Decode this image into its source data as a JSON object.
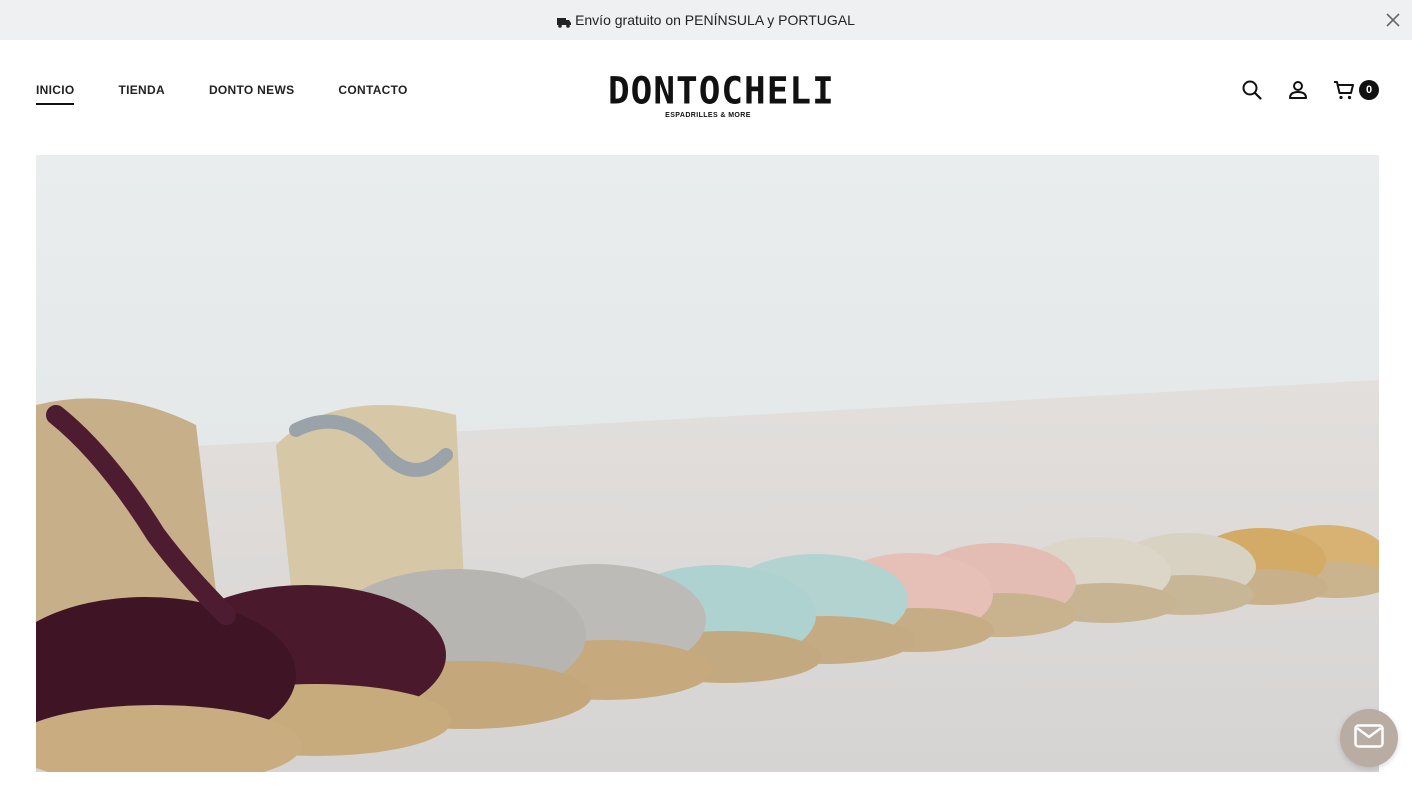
{
  "announcement": {
    "icon": "truck-icon",
    "text": "Envío gratuito on PENÍNSULA y PORTUGAL",
    "close_icon": "close-icon"
  },
  "nav": {
    "items": [
      {
        "label": "INICIO",
        "active": true
      },
      {
        "label": "TIENDA",
        "active": false
      },
      {
        "label": "DONTO NEWS",
        "active": false
      },
      {
        "label": "CONTACTO",
        "active": false
      }
    ]
  },
  "logo": {
    "main": "DONTOCHELI",
    "sub": "ESPADRILLES & MORE"
  },
  "actions": {
    "search_icon": "search-icon",
    "account_icon": "user-icon",
    "cart_icon": "cart-icon",
    "cart_count": "0"
  },
  "hero": {
    "image": "row of espadrilles in burgundy, grey, mint, pink, beige and mustard on a light floor"
  },
  "chat": {
    "icon": "mail-icon"
  },
  "colors": {
    "announce_bg": "#eef0f2",
    "text": "#1a1a1a",
    "badge": "#111111",
    "chat_bg": "#b9ada3"
  }
}
